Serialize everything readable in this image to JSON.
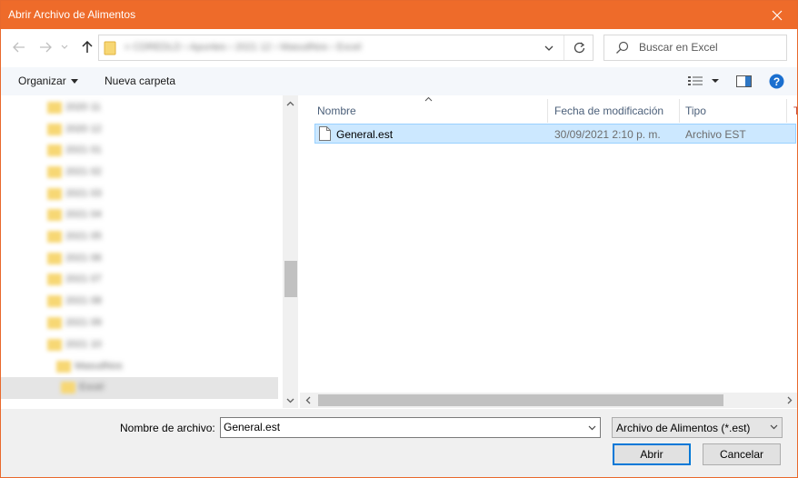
{
  "window": {
    "title": "Abrir Archivo de Alimentos"
  },
  "address": {
    "crumbs": "«  CDREDLD  ›  Apuntes  ›  2021 12  ›  MasudNos  ›  Excel"
  },
  "search": {
    "placeholder": "Buscar en Excel"
  },
  "toolbar": {
    "organize_label": "Organizar",
    "new_folder_label": "Nueva carpeta"
  },
  "nav_pane": {
    "items": [
      {
        "label": "2020 11"
      },
      {
        "label": "2020 12"
      },
      {
        "label": "2021 01"
      },
      {
        "label": "2021 02"
      },
      {
        "label": "2021 03"
      },
      {
        "label": "2021 04"
      },
      {
        "label": "2021 05"
      },
      {
        "label": "2021 06"
      },
      {
        "label": "2021 07"
      },
      {
        "label": "2021 08"
      },
      {
        "label": "2021 09"
      },
      {
        "label": "2021 10"
      },
      {
        "label": "MasudNos"
      },
      {
        "label": "Excel"
      }
    ]
  },
  "file_list": {
    "columns": [
      "Nombre",
      "Fecha de modificación",
      "Tipo",
      "T"
    ],
    "rows": [
      {
        "name": "General.est",
        "modified": "30/09/2021 2:10 p. m.",
        "type": "Archivo EST"
      }
    ]
  },
  "bottom": {
    "filename_label": "Nombre de archivo:",
    "filename_value": "General.est",
    "filter_value": "Archivo de Alimentos (*.est)",
    "open_label": "Abrir",
    "cancel_label": "Cancelar"
  },
  "colors": {
    "title_bar": "#ee6b2a",
    "selection": "#cce8ff",
    "accent": "#0078d7",
    "folder": "#f7d774"
  }
}
